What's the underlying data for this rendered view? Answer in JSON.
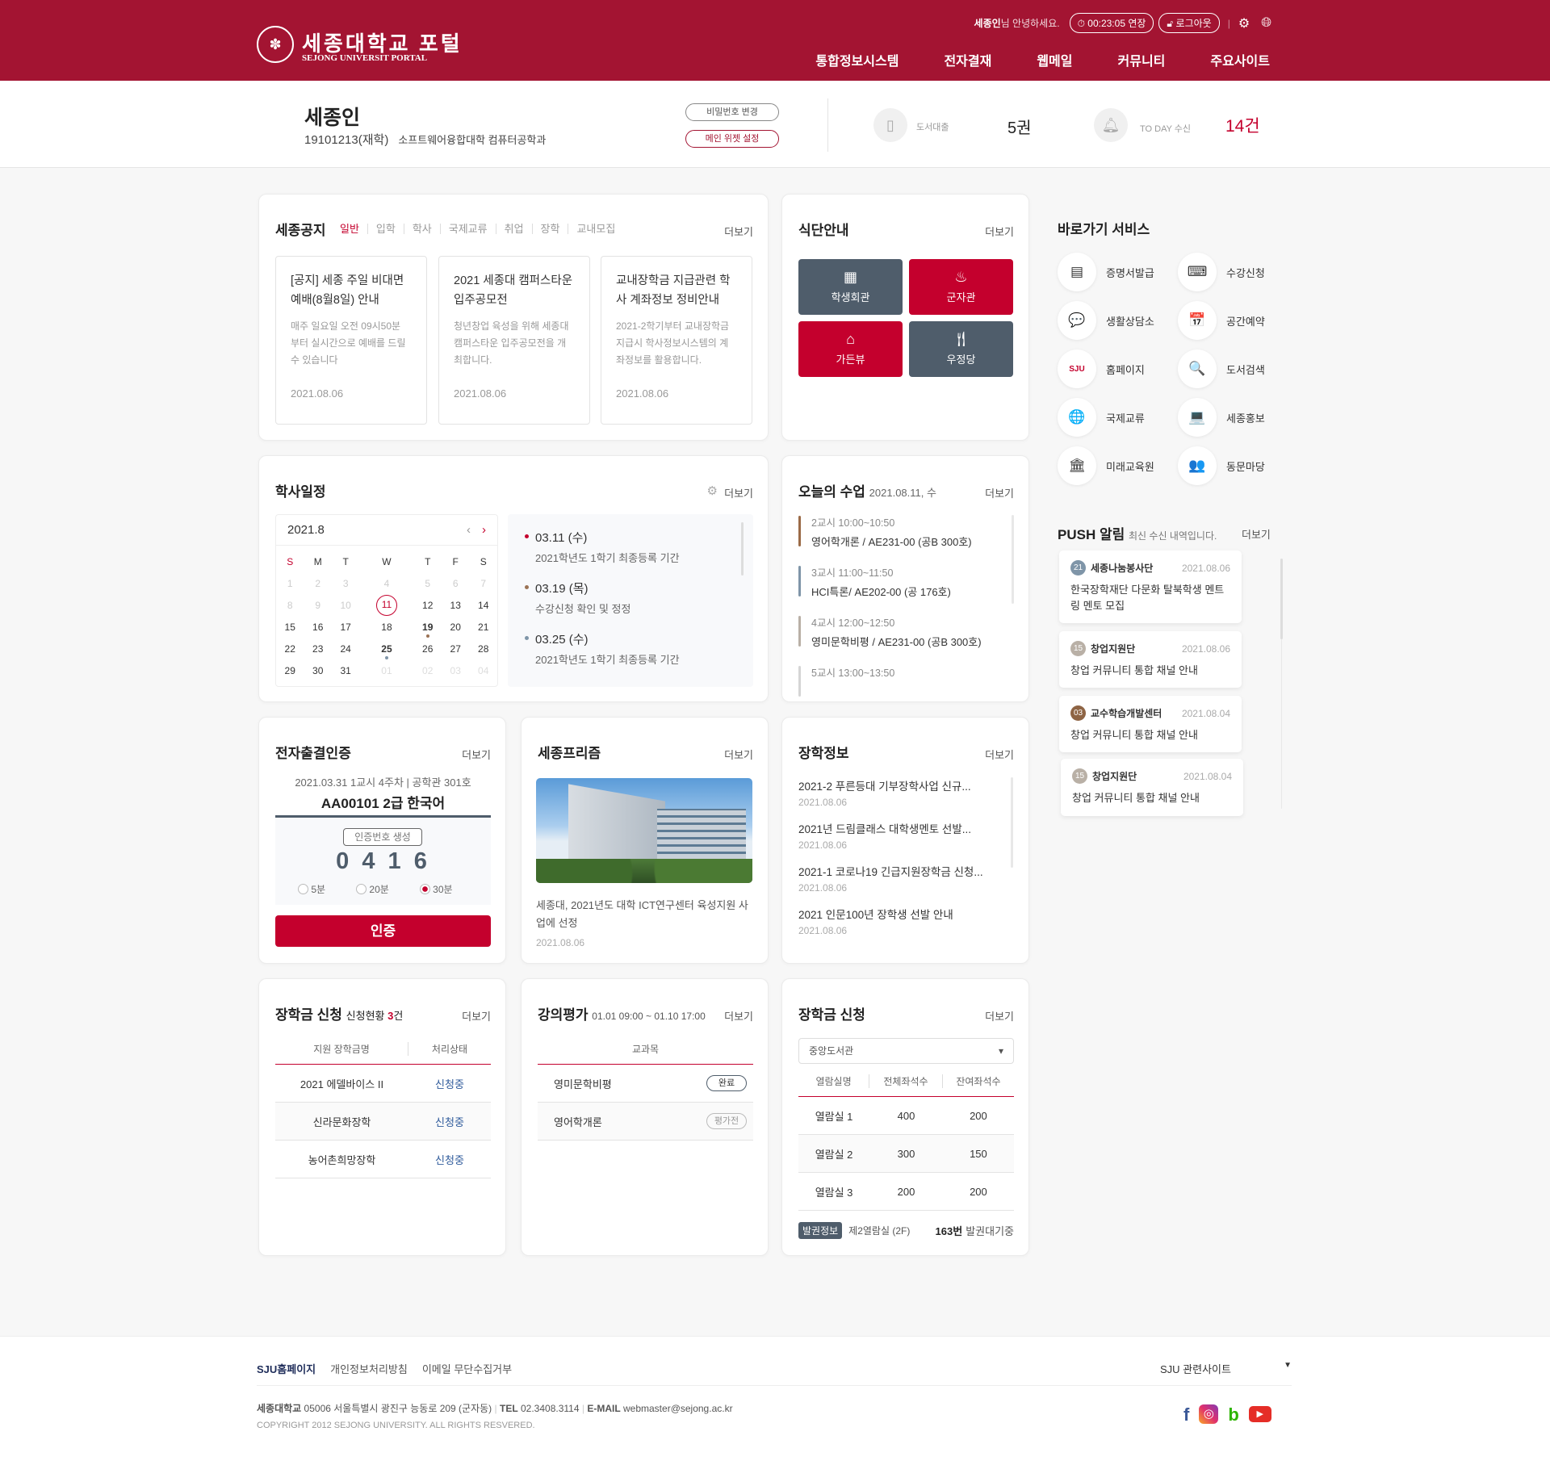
{
  "header": {
    "logo_ko": "세종대학교 포털",
    "logo_en": "SEJONG UNIVERSIT PORTAL",
    "user_bold": "세종인",
    "greeting": "님 안녕하세요.",
    "timer": "00:23:05 연장",
    "logout": "로그아웃",
    "nav": [
      "통합정보시스템",
      "전자결재",
      "웹메일",
      "커뮤니티",
      "주요사이트"
    ]
  },
  "profile": {
    "name": "세종인",
    "id": "19101213(재학)",
    "dept": "소프트웨어융합대학 컴퓨터공학과",
    "btn_pw": "비밀번호 변경",
    "btn_widget": "메인 위젯 설정",
    "loan_label": "도서대출",
    "loan_value": "5권",
    "today_label": "TO DAY 수신",
    "today_value": "14건"
  },
  "more": "더보기",
  "notice": {
    "title": "세종공지",
    "tabs": [
      "일반",
      "입학",
      "학사",
      "국제교류",
      "취업",
      "장학",
      "교내모집"
    ],
    "items": [
      {
        "title": "[공지] 세종 주일 비대면 예배(8월8일) 안내",
        "desc": "매주 일요일 오전 09시50분 부터 실시간으로 예배를 드릴수 있습니다",
        "date": "2021.08.06"
      },
      {
        "title": "2021 세종대 캠퍼스타운 입주공모전",
        "desc": "청년창업 육성을 위해 세종대 캠퍼스타운 입주공모전을 개최합니다.",
        "date": "2021.08.06"
      },
      {
        "title": "교내장학금 지급관련 학사 계좌정보 정비안내",
        "desc": "2021-2학기부터 교내장학금 지급시 학사정보시스템의 계좌정보를 활용합니다.",
        "date": "2021.08.06"
      }
    ]
  },
  "menu": {
    "title": "식단안내",
    "tiles": [
      {
        "label": "학생회관",
        "color": "#4f5d6b"
      },
      {
        "label": "군자관",
        "color": "#c4002d"
      },
      {
        "label": "가든뷰",
        "color": "#c4002d"
      },
      {
        "label": "우정당",
        "color": "#4f5d6b"
      }
    ]
  },
  "schedule": {
    "title": "학사일정",
    "month": "2021.8",
    "dow": [
      "S",
      "M",
      "T",
      "W",
      "T",
      "F",
      "S"
    ],
    "weeks": [
      [
        "1",
        "2",
        "3",
        "4",
        "5",
        "6",
        "7"
      ],
      [
        "8",
        "9",
        "10",
        "11",
        "12",
        "13",
        "14"
      ],
      [
        "15",
        "16",
        "17",
        "18",
        "19",
        "20",
        "21"
      ],
      [
        "22",
        "23",
        "24",
        "25",
        "26",
        "27",
        "28"
      ],
      [
        "29",
        "30",
        "31",
        "01",
        "02",
        "03",
        "04"
      ]
    ],
    "today": "11",
    "events": [
      {
        "date": "03.11 (수)",
        "text": "2021학년도 1학기 최종등록 기간",
        "color": "#c4002d"
      },
      {
        "date": "03.19 (목)",
        "text": "수강신청 확인 및 정정",
        "color": "#9b7355"
      },
      {
        "date": "03.25 (수)",
        "text": "2021학년도 1학기 최종등록 기간",
        "color": "#7f95a8"
      }
    ]
  },
  "classes": {
    "title": "오늘의 수업",
    "date": "2021.08.11, 수",
    "items": [
      {
        "time": "2교시  10:00~10:50",
        "name": "영어학개론 / AE231-00 (공B 300호)",
        "color": "#9b6b47"
      },
      {
        "time": "3교시  11:00~11:50",
        "name": "HCI특론/ AE202-00 (공 176호)",
        "color": "#7f95a8"
      },
      {
        "time": "4교시  12:00~12:50",
        "name": "영미문학비평 / AE231-00 (공B 300호)",
        "color": "#b9b0a6"
      },
      {
        "time": "5교시  13:00~13:50",
        "name": "",
        "color": "#d5d5d5"
      }
    ]
  },
  "attend": {
    "title": "전자출결인증",
    "info": "2021.03.31 1교시 4주차 | 공학관 301호",
    "course": "AA00101 2급 한국어",
    "gen": "인증번호 생성",
    "code": "0 4 1 6",
    "options": [
      "5분",
      "20분",
      "30분"
    ],
    "selected": "30분",
    "btn": "인증"
  },
  "prism": {
    "title": "세종프리즘",
    "text": "세종대, 2021년도 대학 ICT연구센터 육성지원 사업에 선정",
    "date": "2021.08.06"
  },
  "schinfo": {
    "title": "장학정보",
    "items": [
      {
        "t": "2021-2 푸른등대 기부장학사업 신규...",
        "d": "2021.08.06"
      },
      {
        "t": "2021년 드림클래스 대학생멘토 선발...",
        "d": "2021.08.06"
      },
      {
        "t": "2021-1 코로나19 긴급지원장학금 신청...",
        "d": "2021.08.06"
      },
      {
        "t": "2021 인문100년 장학생 선발 안내",
        "d": "2021.08.06"
      }
    ]
  },
  "scholar": {
    "title": "장학금 신청",
    "sub": "신청현황",
    "count": "3",
    "unit": "건",
    "cols": [
      "지원 장학금명",
      "처리상태"
    ],
    "rows": [
      [
        "2021 에델바이스 II",
        "신청중"
      ],
      [
        "신라문화장학",
        "신청중"
      ],
      [
        "농어촌희망장학",
        "신청중"
      ]
    ]
  },
  "eval": {
    "title": "강의평가",
    "period": "01.01 09:00 ~ 01.10 17:00",
    "col": "교과목",
    "rows": [
      [
        "영미문학비평",
        "완료"
      ],
      [
        "영어학개론",
        "평가전"
      ]
    ]
  },
  "library": {
    "title": "장학금 신청",
    "select": "중앙도서관",
    "cols": [
      "열람실명",
      "전체좌석수",
      "잔여좌석수"
    ],
    "rows": [
      [
        "열람실 1",
        "400",
        "200"
      ],
      [
        "열람실 2",
        "300",
        "150"
      ],
      [
        "열람실 3",
        "200",
        "200"
      ]
    ],
    "badge": "발권정보",
    "room": "제2열람실 (2F)",
    "num": "163번",
    "wait": "발권대기중"
  },
  "quick": {
    "title": "바로가기 서비스",
    "items": [
      {
        "label": "증명서발급",
        "icon": "certificate-icon",
        "g": "▤"
      },
      {
        "label": "수강신청",
        "icon": "laptop-cursor-icon",
        "g": "⌨"
      },
      {
        "label": "생활상담소",
        "icon": "chat-icon",
        "g": "💬"
      },
      {
        "label": "공간예약",
        "icon": "calendar-clock-icon",
        "g": "📅"
      },
      {
        "label": "홈페이지",
        "icon": "monitor-sju-icon",
        "g": "SJU"
      },
      {
        "label": "도서검색",
        "icon": "book-search-icon",
        "g": "🔍"
      },
      {
        "label": "국제교류",
        "icon": "globe-hand-icon",
        "g": "🌐"
      },
      {
        "label": "세종홍보",
        "icon": "laptop-message-icon",
        "g": "💻"
      },
      {
        "label": "미래교육원",
        "icon": "building-icon",
        "g": "🏛"
      },
      {
        "label": "동문마당",
        "icon": "people-icon",
        "g": "👥"
      }
    ]
  },
  "push": {
    "title": "PUSH 알림",
    "sub": "최신 수신 내역입니다.",
    "items": [
      {
        "n": "21",
        "from": "세종나눔봉사단",
        "date": "2021.08.06",
        "text": "한국장학재단 다문화 탈북학생 멘트링 멘토 모집",
        "color": "#7f95a8"
      },
      {
        "n": "15",
        "from": "창업지원단",
        "date": "2021.08.06",
        "text": "창업 커뮤니티 통합 채널 안내",
        "color": "#b9b0a6"
      },
      {
        "n": "03",
        "from": "교수학습개발센터",
        "date": "2021.08.04",
        "text": "창업 커뮤니티 통합 채널 안내",
        "color": "#8e6444"
      },
      {
        "n": "15",
        "from": "창업지원단",
        "date": "2021.08.04",
        "text": "창업 커뮤니티 통합 채널 안내",
        "color": "#b9b0a6"
      }
    ]
  },
  "footer": {
    "links": [
      "SJU홈페이지",
      "개인정보처리방침",
      "이메일 무단수집거부"
    ],
    "related": "SJU 관련사이트",
    "addr_name": "세종대학교",
    "addr": "05006 서울특별시 광진구 능동로 209 (군자동)",
    "tel_label": "TEL",
    "tel": "02.3408.3114",
    "mail_label": "E-MAIL",
    "mail": "webmaster@sejong.ac.kr",
    "copy": "COPYRIGHT 2012 SEJONG UNIVERSITY. ALL RIGHTS RESVERED.",
    "social": [
      "facebook",
      "instagram",
      "blog",
      "youtube"
    ]
  }
}
